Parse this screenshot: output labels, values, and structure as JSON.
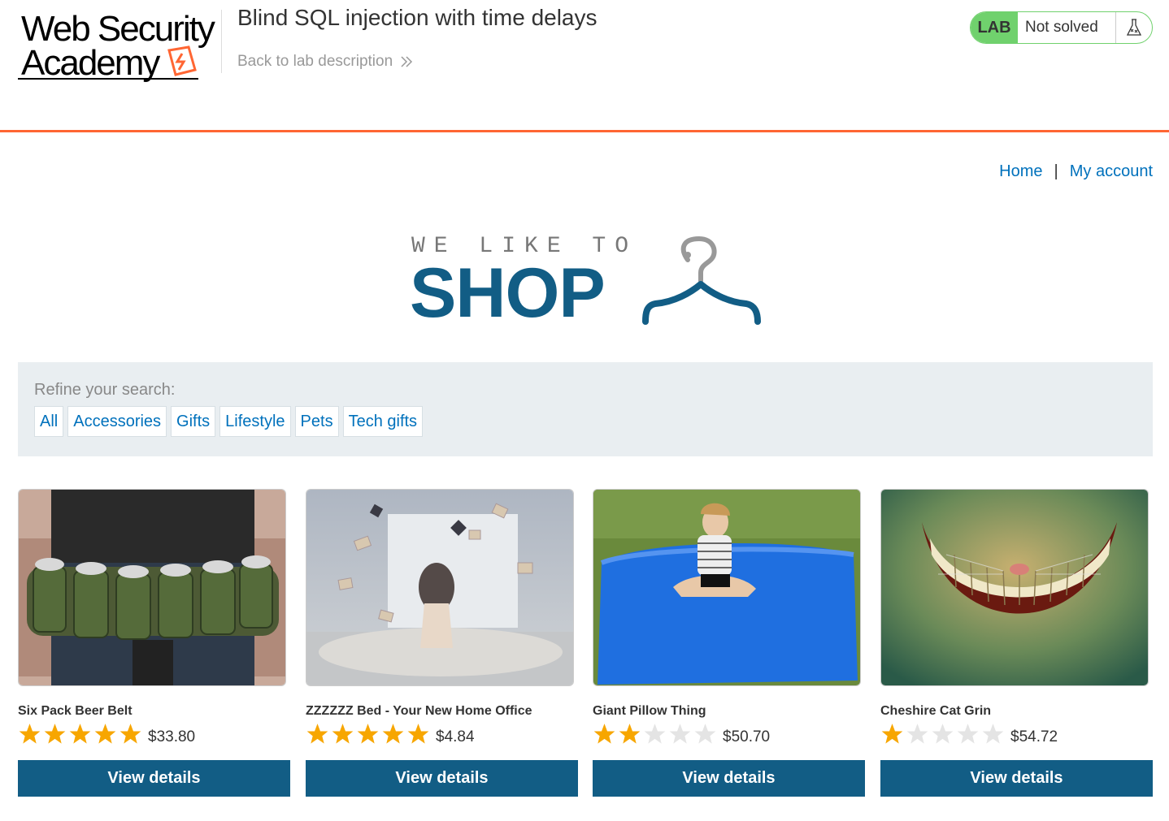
{
  "header": {
    "logo_line1": "Web Security",
    "logo_line2": "Academy",
    "lab_title": "Blind SQL injection with time delays",
    "back_link": "Back to lab description",
    "lab_badge": "LAB",
    "lab_status": "Not solved",
    "accent_color": "#ff6633"
  },
  "nav": {
    "home": "Home",
    "separator": "|",
    "my_account": "My account"
  },
  "banner": {
    "tagline": "WE LIKE TO",
    "shop": "SHOP",
    "color": "#125d85"
  },
  "filters": {
    "label": "Refine your search:",
    "items": [
      "All",
      "Accessories",
      "Gifts",
      "Lifestyle",
      "Pets",
      "Tech gifts"
    ]
  },
  "products": [
    {
      "name": "Six Pack Beer Belt",
      "rating": 5,
      "price": "$33.80",
      "button": "View details"
    },
    {
      "name": "ZZZZZZ Bed - Your New Home Office",
      "rating": 5,
      "price": "$4.84",
      "button": "View details"
    },
    {
      "name": "Giant Pillow Thing",
      "rating": 2,
      "price": "$50.70",
      "button": "View details"
    },
    {
      "name": "Cheshire Cat Grin",
      "rating": 1,
      "price": "$54.72",
      "button": "View details"
    }
  ]
}
